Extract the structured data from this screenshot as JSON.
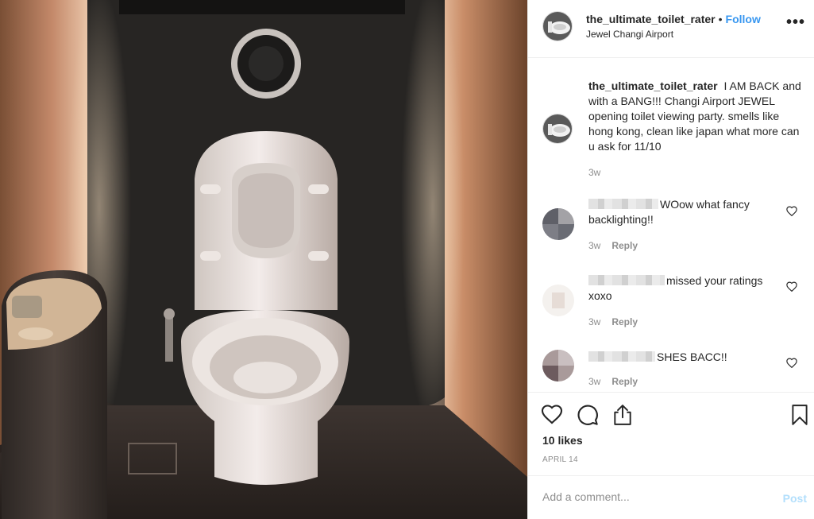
{
  "post": {
    "username": "the_ultimate_toilet_rater",
    "separator": "•",
    "follow_label": "Follow",
    "location": "Jewel Changi Airport",
    "more_label": "•••",
    "caption_username": "the_ultimate_toilet_rater",
    "caption_text": "I AM BACK and with a BANG!!! Changi Airport JEWEL opening toilet viewing party. smells like hong kong, clean like japan what more can u ask for 11/10",
    "caption_time": "3w",
    "likes": "10 likes",
    "date": "APRIL 14",
    "comment_placeholder": "Add a comment...",
    "post_label": "Post"
  },
  "comments": [
    {
      "text": "WOow what fancy backlighting!!",
      "time": "3w",
      "reply_label": "Reply"
    },
    {
      "text": "missed your ratings xoxo",
      "time": "3w",
      "reply_label": "Reply"
    },
    {
      "text": "SHES BACC!!",
      "time": "3w",
      "reply_label": "Reply"
    }
  ],
  "colors": {
    "link": "#3897f0",
    "muted": "#8e8e8e",
    "text": "#262626",
    "post_disabled": "#b2dffc"
  }
}
